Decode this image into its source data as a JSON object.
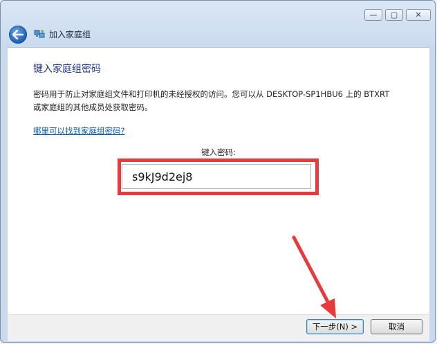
{
  "window": {
    "title": "加入家庭组",
    "controls": {
      "minimize": "—",
      "maximize": "▢",
      "close": "✕"
    }
  },
  "main": {
    "heading": "键入家庭组密码",
    "description": "密码用于防止对家庭组文件和打印机的未经授权的访问。您可以从 DESKTOP-SP1HBU6 上的 BTXRT 或家庭组的其他成员处获取密码。",
    "help_link": "哪里可以找到家庭组密码?",
    "password_label": "键入密码:",
    "password_value": "s9kJ9d2ej8"
  },
  "footer": {
    "next_label": "下一步(N) >",
    "cancel_label": "取消"
  },
  "colors": {
    "highlight": "#e8393c",
    "heading": "#1e3287",
    "link": "#0b5aa8"
  },
  "icons": [
    "back-arrow-icon",
    "homegroup-icon",
    "minimize-icon",
    "maximize-icon",
    "close-icon",
    "annotation-arrow"
  ]
}
